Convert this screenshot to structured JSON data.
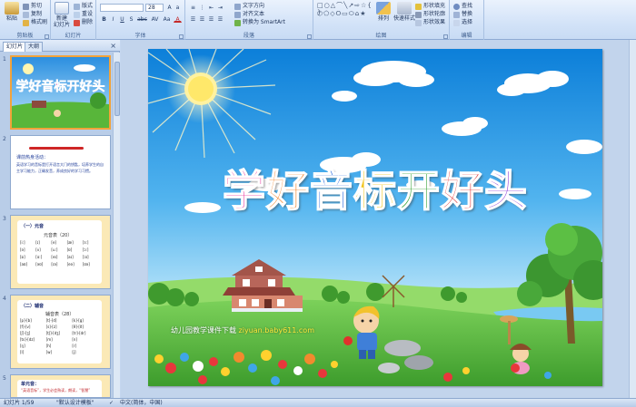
{
  "ribbon": {
    "clipboard": {
      "paste": "粘贴",
      "cut": "剪切",
      "copy": "复制",
      "format_painter": "格式刷",
      "label": "剪贴板"
    },
    "slides": {
      "new_slide": "新建",
      "new_slide_2": "幻灯片",
      "layout": "版式",
      "reset": "重设",
      "delete": "删除",
      "label": "幻灯片"
    },
    "font": {
      "size": "28",
      "bold": "B",
      "italic": "I",
      "underline": "U",
      "shadow": "S",
      "strike": "abc",
      "spacing": "AV",
      "case": "Aa",
      "color": "A",
      "label": "字体"
    },
    "paragraph": {
      "text_direction": "文字方向",
      "align_text": "对齐文本",
      "smartart": "转换为 SmartArt",
      "label": "段落"
    },
    "drawing": {
      "arrange": "排列",
      "quick_styles": "快速样式",
      "shape_fill": "形状填充",
      "shape_outline": "形状轮廓",
      "shape_effects": "形状效果",
      "shapes": "□○△⌒╲↗⇨☆{ }",
      "label": "绘图"
    },
    "editing": {
      "find": "查找",
      "replace": "替换",
      "select": "选择",
      "label": "编辑"
    }
  },
  "panel": {
    "tab_slides": "幻灯片",
    "tab_outline": "大纲",
    "close": "×",
    "thumbs": [
      {
        "num": "1",
        "title": "学好音标开好头"
      },
      {
        "num": "2",
        "heading": "课前热身活动：",
        "text": "英语学习的音标是打开语言大门的钥匙，培养学生的自主学习能力，正确发音，养成良好的学习习惯。"
      },
      {
        "num": "3",
        "heading": "（一）元音",
        "subtitle": "元音表（20）",
        "cells": [
          "[i:]",
          "[ɪ]",
          "[e]",
          "[æ]",
          "[ɜ:]",
          "[ə]",
          "[ʌ]",
          "[u:]",
          "[ʊ]",
          "[ɔ:]",
          "[ɒ]",
          "[ɑ:]",
          "[eɪ]",
          "[aɪ]",
          "[ɔɪ]",
          "[aʊ]",
          "[əʊ]",
          "[ɪə]",
          "[eə]",
          "[ʊə]"
        ]
      },
      {
        "num": "4",
        "heading": "（二）辅音",
        "subtitle": "辅音表（28）",
        "cells": [
          "[p]-[b]",
          "[t]-[d]",
          "[k]-[g]",
          "[f]-[v]",
          "[s]-[z]",
          "[θ]-[ð]",
          "[ʃ]-[ʒ]",
          "[tʃ]-[dʒ]",
          "[tr]-[dr]",
          "[ts]-[dz]",
          "[m]",
          "[n]",
          "[ŋ]",
          "[h]",
          "[r]",
          "[l]",
          "[w]",
          "[j]"
        ]
      },
      {
        "num": "5",
        "heading": "单元音：",
        "text": "“英语音标”，学生必会熟读，朗读，“智慧”"
      }
    ]
  },
  "slide": {
    "title_chars": [
      "学",
      "好",
      "音",
      "标",
      "开",
      "好",
      "头"
    ],
    "credit_prefix": "幼儿园教学课件下载",
    "credit_url": "ziyuan.baby611.com"
  },
  "status": {
    "slide_count": "幻灯片 1/59",
    "theme": "\"默认设计模板\"",
    "language": "中文(简体，中国)"
  },
  "colors": {
    "title": [
      "#e8329c",
      "#f07a1a",
      "#2f6fe0",
      "#f2c51d",
      "#3aa33a",
      "#e03a3a",
      "#8b3ad8"
    ]
  }
}
